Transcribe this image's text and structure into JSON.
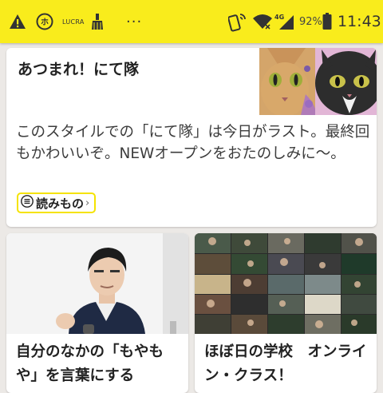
{
  "status_bar": {
    "icons_left": [
      "warning-icon",
      "notification-app-icon",
      "broom-icon"
    ],
    "lucra_label": "LUCRA",
    "overflow": "···",
    "battery_percent": "92%",
    "time": "11:43",
    "network_label": "4G",
    "colors": {
      "background": "#f9ec1c"
    }
  },
  "feed": {
    "featured": {
      "title": "あつまれ！にて隊",
      "description": "このスタイルでの「にて隊」は今日がラスト。最終回もかわいいぞ。NEWオープンをおたのしみに〜。",
      "tag": "読みもの",
      "tag_arrow": "›"
    },
    "cards": [
      {
        "title": "自分のなかの「もやもや」を言葉にする"
      },
      {
        "title": "ほぼ日の学校　オンライン・クラス！"
      }
    ]
  },
  "colors": {
    "accent": "#f5e300",
    "page_bg": "#ece9e6"
  }
}
